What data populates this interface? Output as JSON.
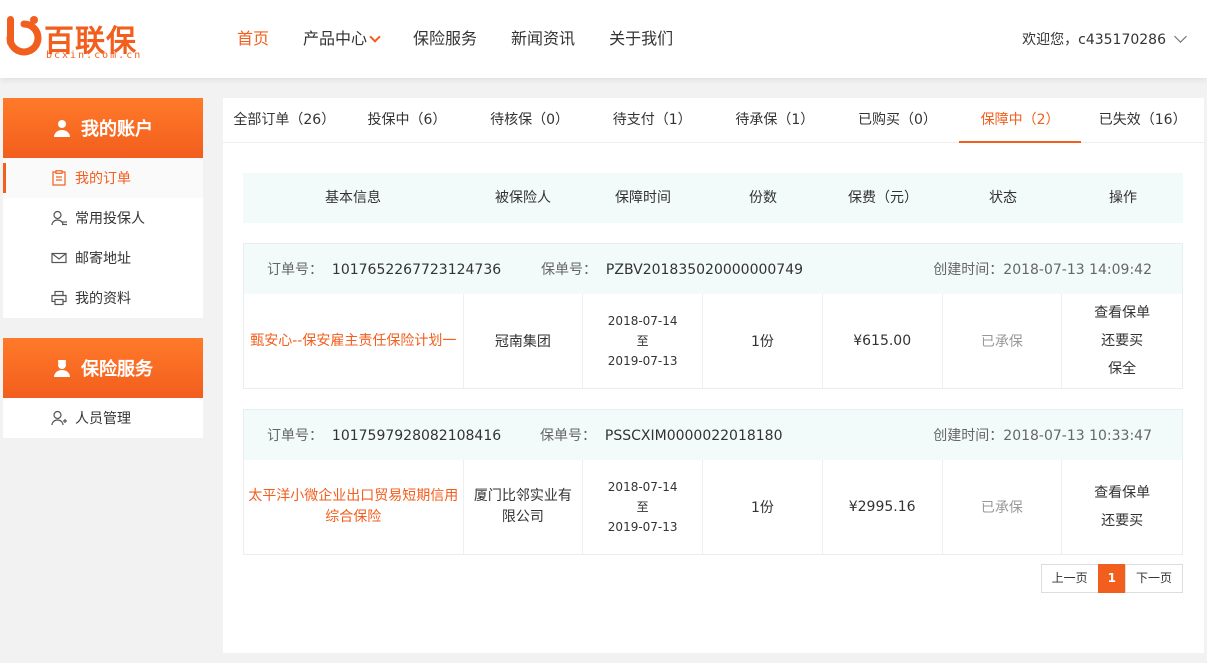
{
  "brand": {
    "name": "百联保",
    "domain": "bcxin.com.cn",
    "accent": "#f25e1d"
  },
  "nav": {
    "items": [
      {
        "label": "首页",
        "active": true
      },
      {
        "label": "产品中心",
        "has_dropdown": true
      },
      {
        "label": "保险服务"
      },
      {
        "label": "新闻资讯"
      },
      {
        "label": "关于我们"
      }
    ]
  },
  "user": {
    "greeting": "欢迎您，c435170286"
  },
  "sidebar": {
    "account": {
      "title": "我的账户",
      "items": [
        {
          "label": "我的订单",
          "icon": "order-icon",
          "active": true
        },
        {
          "label": "常用投保人",
          "icon": "user-add-icon"
        },
        {
          "label": "邮寄地址",
          "icon": "mail-icon"
        },
        {
          "label": "我的资料",
          "icon": "printer-icon"
        }
      ]
    },
    "service": {
      "title": "保险服务",
      "items": [
        {
          "label": "人员管理",
          "icon": "user-manage-icon"
        }
      ]
    }
  },
  "tabs": [
    {
      "label": "全部订单（26）"
    },
    {
      "label": "投保中（6）"
    },
    {
      "label": "待核保（0）"
    },
    {
      "label": "待支付（1）"
    },
    {
      "label": "待承保（1）"
    },
    {
      "label": "已购买（0）"
    },
    {
      "label": "保障中（2）",
      "active": true
    },
    {
      "label": "已失效（16）"
    }
  ],
  "table": {
    "headers": [
      "基本信息",
      "被保险人",
      "保障时间",
      "份数",
      "保费（元）",
      "状态",
      "操作"
    ]
  },
  "orders": [
    {
      "order_label": "订单号：",
      "order_no": "1017652267723124736",
      "policy_label": "保单号：",
      "policy_no": "PZBV201835020000000749",
      "created_label": "创建时间：",
      "created": "2018-07-13 14:09:42",
      "product": "甄安心--保安雇主责任保险计划一",
      "insured": "冠南集团",
      "start": "2018-07-14",
      "to": "至",
      "end": "2019-07-13",
      "copies": "1份",
      "premium": "¥615.00",
      "status": "已承保",
      "ops": [
        "查看保单",
        "还要买",
        "保全"
      ]
    },
    {
      "order_label": "订单号：",
      "order_no": "1017597928082108416",
      "policy_label": "保单号：",
      "policy_no": "PSSCXIM0000022018180",
      "created_label": "创建时间：",
      "created": "2018-07-13 10:33:47",
      "product": "太平洋小微企业出口贸易短期信用综合保险",
      "insured": "厦门比邻实业有限公司",
      "start": "2018-07-14",
      "to": "至",
      "end": "2019-07-13",
      "copies": "1份",
      "premium": "¥2995.16",
      "status": "已承保",
      "ops": [
        "查看保单",
        "还要买"
      ]
    }
  ],
  "pager": {
    "prev": "上一页",
    "current": "1",
    "next": "下一页"
  }
}
